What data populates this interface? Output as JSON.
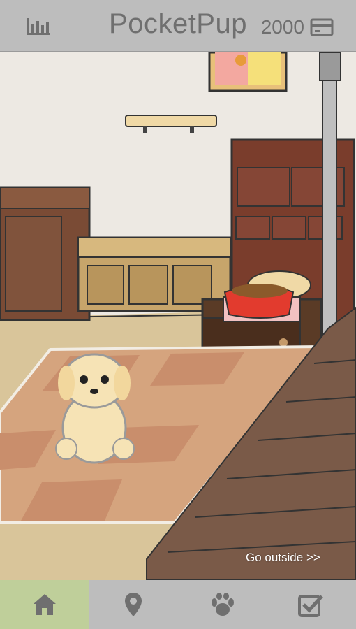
{
  "header": {
    "title": "PocketPup",
    "coins": "2000",
    "stats_icon": "bar-chart-icon",
    "wallet_icon": "credit-card-icon"
  },
  "scene": {
    "go_outside_label": "Go outside >>"
  },
  "tabs": [
    {
      "id": "home",
      "icon": "home-icon",
      "active": true
    },
    {
      "id": "map",
      "icon": "map-pin-icon",
      "active": false
    },
    {
      "id": "pet",
      "icon": "paw-icon",
      "active": false
    },
    {
      "id": "tasks",
      "icon": "checkbox-icon",
      "active": false
    }
  ],
  "colors": {
    "bar_bg": "#bdbdbd",
    "active_tab": "#bfcf9a",
    "icon_gray": "#6f6f6f"
  }
}
